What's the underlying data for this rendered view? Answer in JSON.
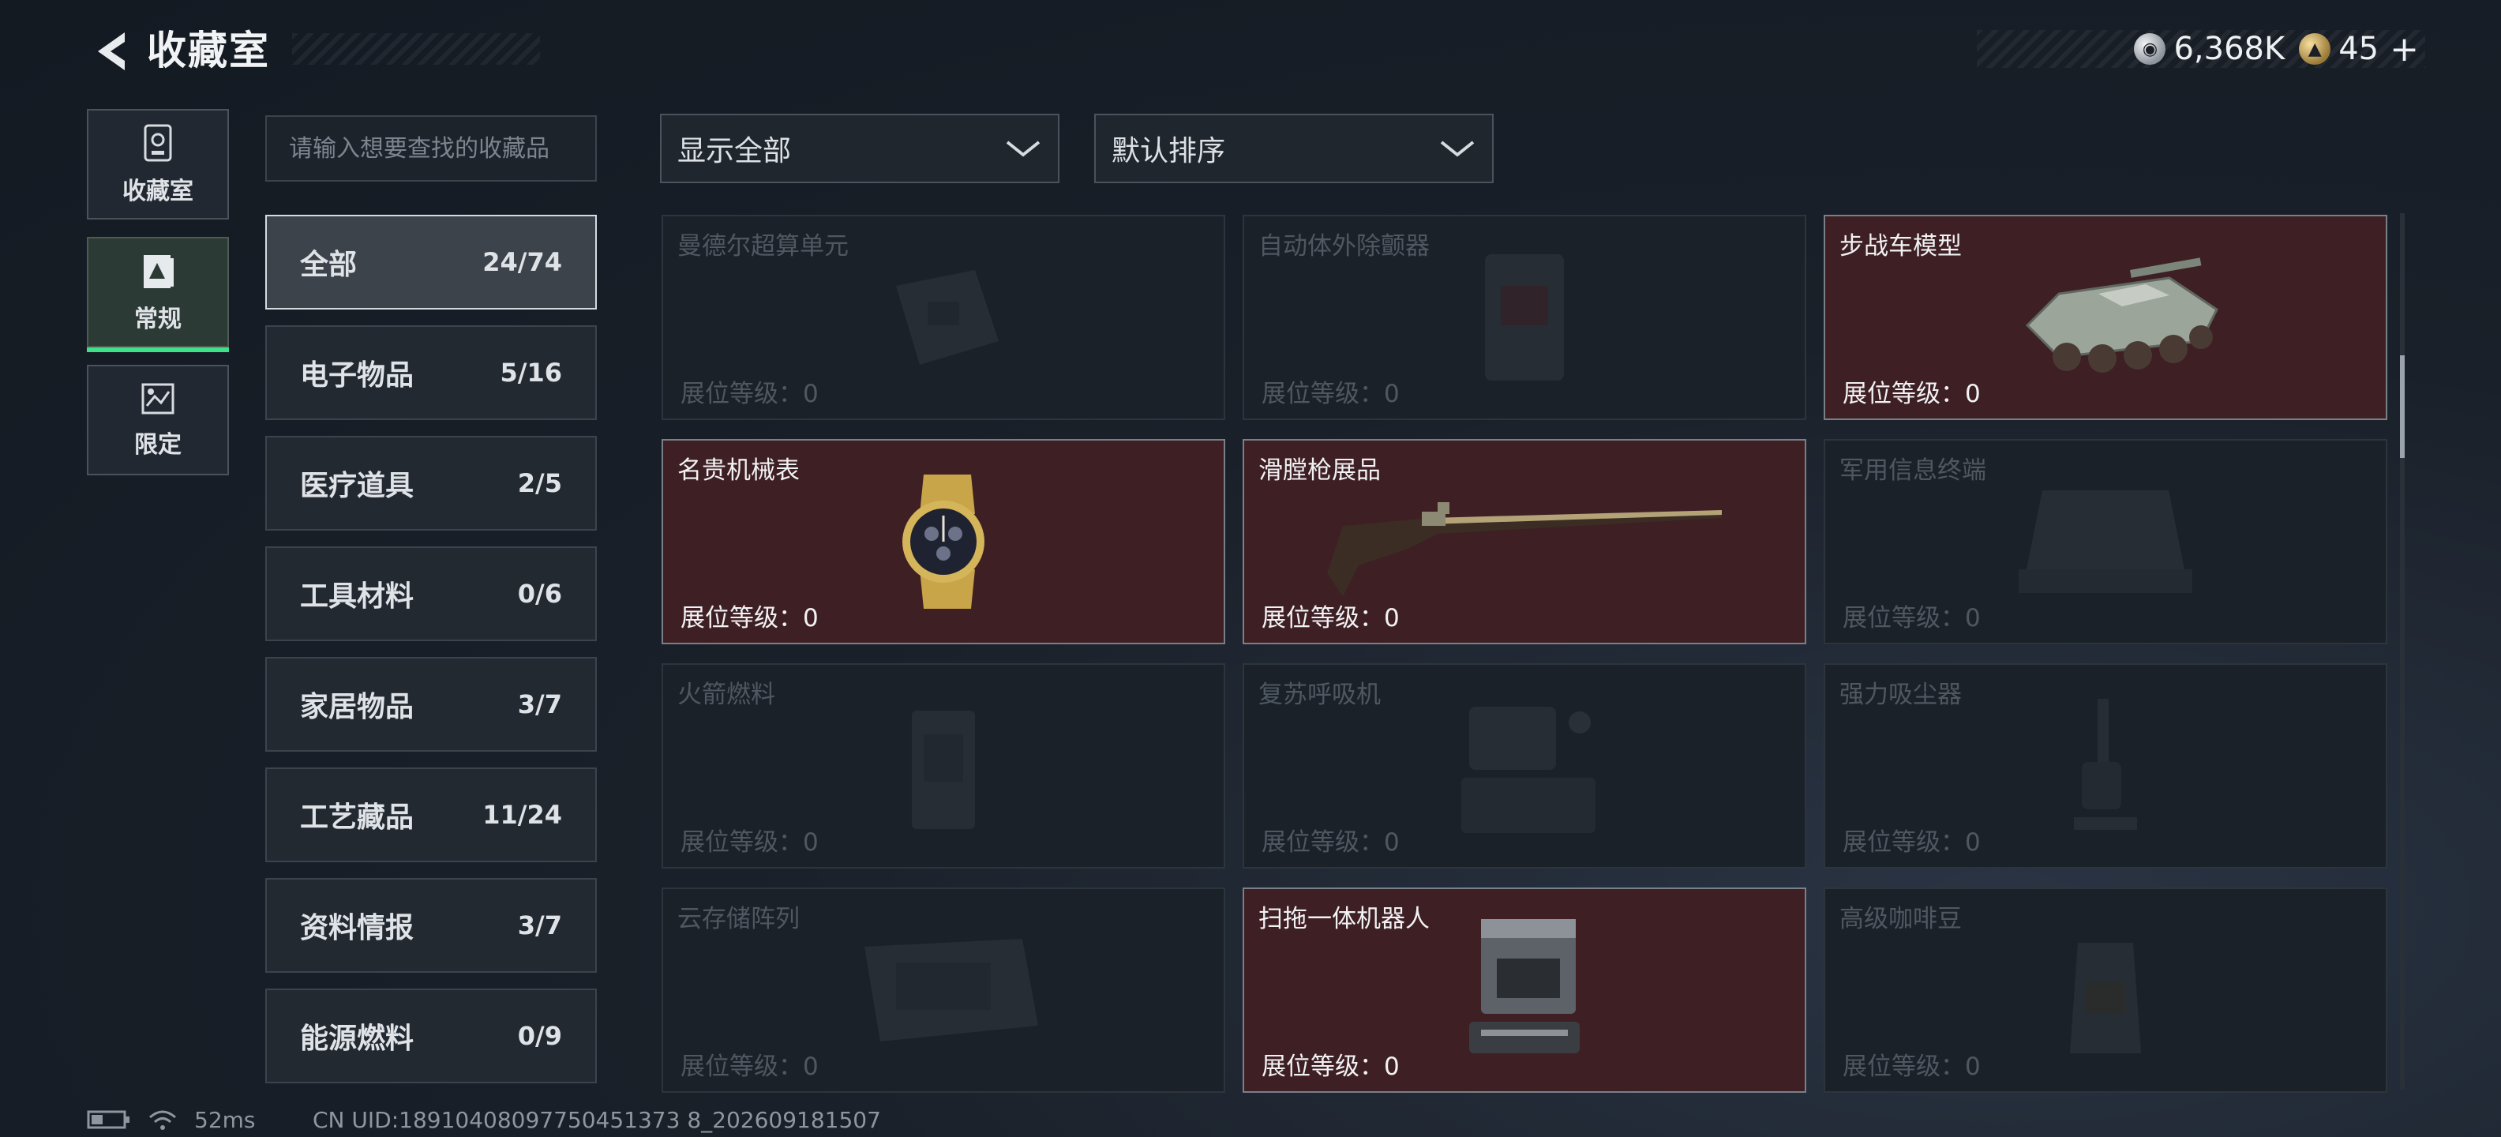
{
  "header": {
    "title": "收藏室",
    "currencies": [
      {
        "icon": "silver-coin-icon",
        "value": "6,368K"
      },
      {
        "icon": "gold-coin-icon",
        "value": "45"
      }
    ],
    "plus": "+"
  },
  "side_tabs": [
    {
      "label": "收藏室",
      "icon": "collection-room-icon",
      "active": false
    },
    {
      "label": "常规",
      "icon": "regular-icon",
      "active": true
    },
    {
      "label": "限定",
      "icon": "limited-icon",
      "active": false
    }
  ],
  "search": {
    "placeholder": "请输入想要查找的收藏品",
    "value": ""
  },
  "categories": [
    {
      "name": "全部",
      "count": "24/74"
    },
    {
      "name": "电子物品",
      "count": "5/16"
    },
    {
      "name": "医疗道具",
      "count": "2/5"
    },
    {
      "name": "工具材料",
      "count": "0/6"
    },
    {
      "name": "家居物品",
      "count": "3/7"
    },
    {
      "name": "工艺藏品",
      "count": "11/24"
    },
    {
      "name": "资料情报",
      "count": "3/7"
    },
    {
      "name": "能源燃料",
      "count": "0/9"
    }
  ],
  "filters": {
    "display": "显示全部",
    "sort": "默认排序"
  },
  "items": [
    {
      "name": "曼德尔超算单元",
      "level": "展位等级：0",
      "owned": false,
      "icon": "computing-unit-icon"
    },
    {
      "name": "自动体外除颤器",
      "level": "展位等级：0",
      "owned": false,
      "icon": "defibrillator-icon"
    },
    {
      "name": "步战车模型",
      "level": "展位等级：0",
      "owned": true,
      "icon": "ifv-model-icon"
    },
    {
      "name": "名贵机械表",
      "level": "展位等级：0",
      "owned": true,
      "icon": "mechanical-watch-icon"
    },
    {
      "name": "滑膛枪展品",
      "level": "展位等级：0",
      "owned": true,
      "icon": "musket-icon"
    },
    {
      "name": "军用信息终端",
      "level": "展位等级：0",
      "owned": false,
      "icon": "military-terminal-icon"
    },
    {
      "name": "火箭燃料",
      "level": "展位等级：0",
      "owned": false,
      "icon": "rocket-fuel-icon"
    },
    {
      "name": "复苏呼吸机",
      "level": "展位等级：0",
      "owned": false,
      "icon": "ventilator-icon"
    },
    {
      "name": "强力吸尘器",
      "level": "展位等级：0",
      "owned": false,
      "icon": "vacuum-cleaner-icon"
    },
    {
      "name": "云存储阵列",
      "level": "展位等级：0",
      "owned": false,
      "icon": "storage-array-icon"
    },
    {
      "name": "扫拖一体机器人",
      "level": "展位等级：0",
      "owned": true,
      "icon": "mopping-robot-icon"
    },
    {
      "name": "高级咖啡豆",
      "level": "展位等级：0",
      "owned": false,
      "icon": "coffee-beans-icon"
    }
  ],
  "status": {
    "ping": "52ms",
    "uid": "CN UID:18910408097750451373 8_202609181507"
  }
}
